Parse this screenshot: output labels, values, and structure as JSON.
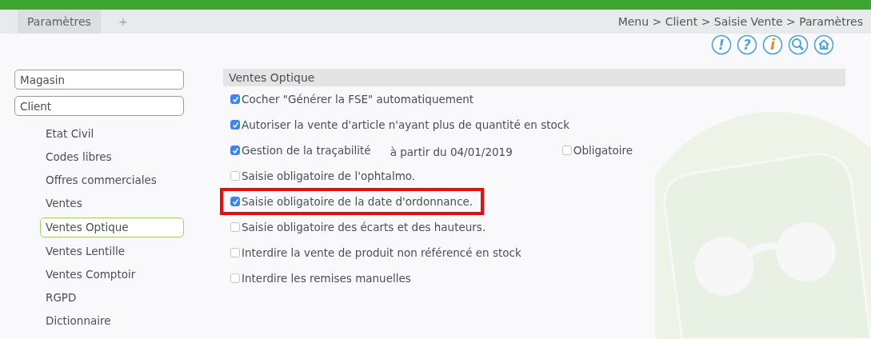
{
  "tabs": [
    {
      "label": "Paramètres",
      "selected": true
    },
    {
      "label": "+",
      "selected": false
    }
  ],
  "breadcrumb": "Menu > Client > Saisie Vente > Paramètres",
  "toolbar": [
    {
      "kind": "alert",
      "glyph": "!"
    },
    {
      "kind": "help",
      "glyph": "?"
    },
    {
      "kind": "info",
      "glyph": "i"
    },
    {
      "kind": "tools"
    },
    {
      "kind": "home"
    }
  ],
  "sidebar": {
    "groups": [
      {
        "label": "Magasin"
      },
      {
        "label": "Client",
        "children": [
          {
            "label": "Etat Civil",
            "selected": false
          },
          {
            "label": "Codes libres",
            "selected": false
          },
          {
            "label": "Offres commerciales",
            "selected": false
          },
          {
            "label": "Ventes",
            "selected": false
          },
          {
            "label": "Ventes Optique",
            "selected": true
          },
          {
            "label": "Ventes Lentille",
            "selected": false
          },
          {
            "label": "Ventes Comptoir",
            "selected": false
          },
          {
            "label": "RGPD",
            "selected": false
          },
          {
            "label": "Dictionnaire",
            "selected": false
          }
        ]
      }
    ]
  },
  "section": {
    "title": "Ventes Optique",
    "options": [
      {
        "kind": "checkbox",
        "label": "Cocher \"Générer la FSE\" automatiquement",
        "checked": true,
        "highlighted": false
      },
      {
        "kind": "checkbox",
        "label": "Autoriser la vente d'article n'ayant plus de quantité en stock",
        "checked": true,
        "highlighted": false
      },
      {
        "kind": "dated",
        "label": "Gestion de la traçabilité",
        "checked": true,
        "highlighted": false,
        "date_text": "à partir du 04/01/2019",
        "extra": {
          "label": "Obligatoire",
          "checked": false
        }
      },
      {
        "kind": "checkbox",
        "label": "Saisie obligatoire de l'ophtalmo.",
        "checked": false,
        "highlighted": false
      },
      {
        "kind": "checkbox",
        "label": "Saisie obligatoire de la date d'ordonnance.",
        "checked": true,
        "highlighted": true
      },
      {
        "kind": "checkbox",
        "label": "Saisie obligatoire des écarts et des hauteurs.",
        "checked": false,
        "highlighted": false
      },
      {
        "kind": "checkbox",
        "label": "Interdire la vente de produit non référencé en stock",
        "checked": false,
        "highlighted": false
      },
      {
        "kind": "checkbox",
        "label": "Interdire les remises manuelles",
        "checked": false,
        "highlighted": false
      }
    ]
  }
}
